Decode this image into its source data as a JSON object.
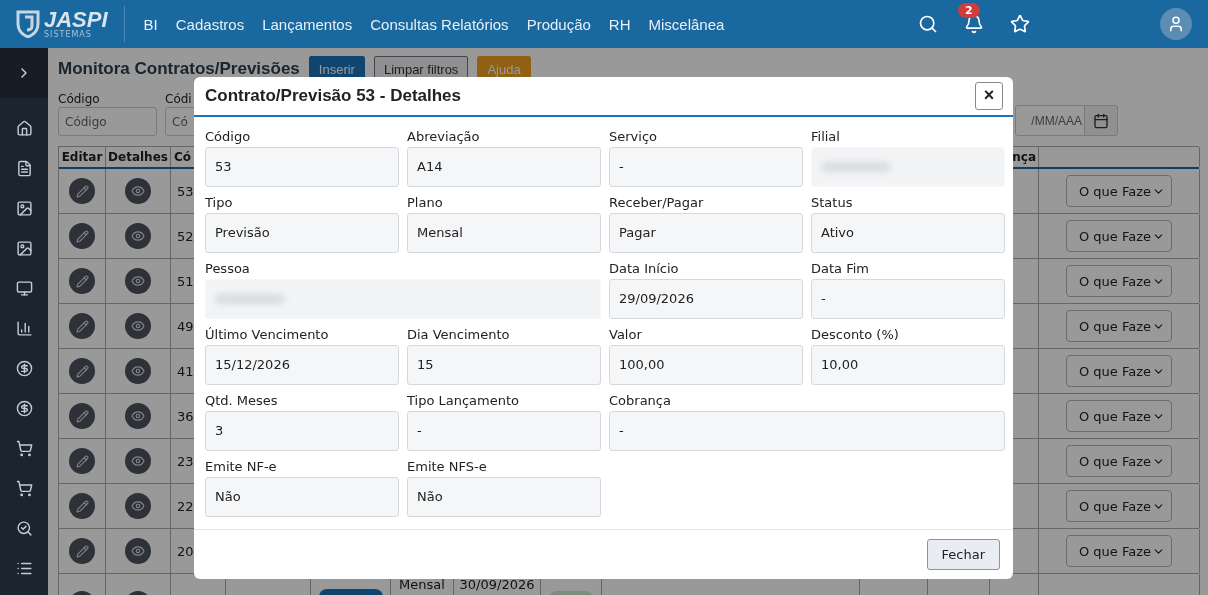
{
  "logo": {
    "name": "JASPI",
    "tagline": "SISTEMAS"
  },
  "nav": [
    "BI",
    "Cadastros",
    "Lançamentos",
    "Consultas Relatórios",
    "Produção",
    "RH",
    "Miscelânea"
  ],
  "notifications": {
    "count": "2"
  },
  "page": {
    "title": "Monitora Contratos/Previsões",
    "buttons": [
      {
        "label": "Inserir",
        "kind": "primary"
      },
      {
        "label": "Limpar filtros",
        "kind": "outline"
      },
      {
        "label": "Ajuda",
        "kind": "warning"
      }
    ]
  },
  "filters": [
    {
      "label": "Código",
      "placeholder": "Código"
    },
    {
      "label": "Códi",
      "placeholder": "Có"
    }
  ],
  "date_filter": {
    "placeholder": "/MM/AAA"
  },
  "table": {
    "columns": [
      "Editar",
      "Detalhes",
      "Có"
    ],
    "right_column": "nça",
    "rows": [
      {
        "code": "53",
        "action": "O que Faze"
      },
      {
        "code": "52",
        "action": "O que Faze"
      },
      {
        "code": "51",
        "action": "O que Faze"
      },
      {
        "code": "49",
        "action": "O que Faze"
      },
      {
        "code": "41",
        "action": "O que Faze"
      },
      {
        "code": "36",
        "action": "O que Faze"
      },
      {
        "code": "23",
        "action": "O que Faze"
      },
      {
        "code": "22",
        "action": "O que Faze"
      },
      {
        "code": "20",
        "action": "O que Faze"
      }
    ],
    "partial_row": {
      "plan": "Mensal",
      "date": "30/09/2026"
    }
  },
  "modal": {
    "title": "Contrato/Previsão 53 - Detalhes",
    "close": "×",
    "footer_button": "Fechar",
    "fields": [
      {
        "label": "Código",
        "value": "53"
      },
      {
        "label": "Abreviação",
        "value": "A14"
      },
      {
        "label": "Serviço",
        "value": "-"
      },
      {
        "label": "Filial",
        "kind": "blurred"
      },
      {
        "label": "Tipo",
        "value": "Previsão"
      },
      {
        "label": "Plano",
        "value": "Mensal"
      },
      {
        "label": "Receber/Pagar",
        "value": "Pagar"
      },
      {
        "label": "Status",
        "value": "Ativo"
      },
      {
        "label": "Pessoa",
        "kind": "blurred",
        "wide": true
      },
      {
        "label": "Data Início",
        "value": "29/09/2026"
      },
      {
        "label": "Data Fim",
        "value": "-"
      },
      {
        "label": "Último Vencimento",
        "value": "15/12/2026"
      },
      {
        "label": "Dia Vencimento",
        "value": "15"
      },
      {
        "label": "Valor",
        "value": "100,00"
      },
      {
        "label": "Desconto (%)",
        "value": "10,00"
      },
      {
        "label": "Qtd. Meses",
        "value": "3"
      },
      {
        "label": "Tipo Lançamento",
        "value": "-"
      },
      {
        "label": "Cobrança",
        "value": "-",
        "wide": true
      },
      {
        "label": "Emite NF-e",
        "value": "Não"
      },
      {
        "label": "Emite NFS-e",
        "value": "Não"
      }
    ]
  }
}
